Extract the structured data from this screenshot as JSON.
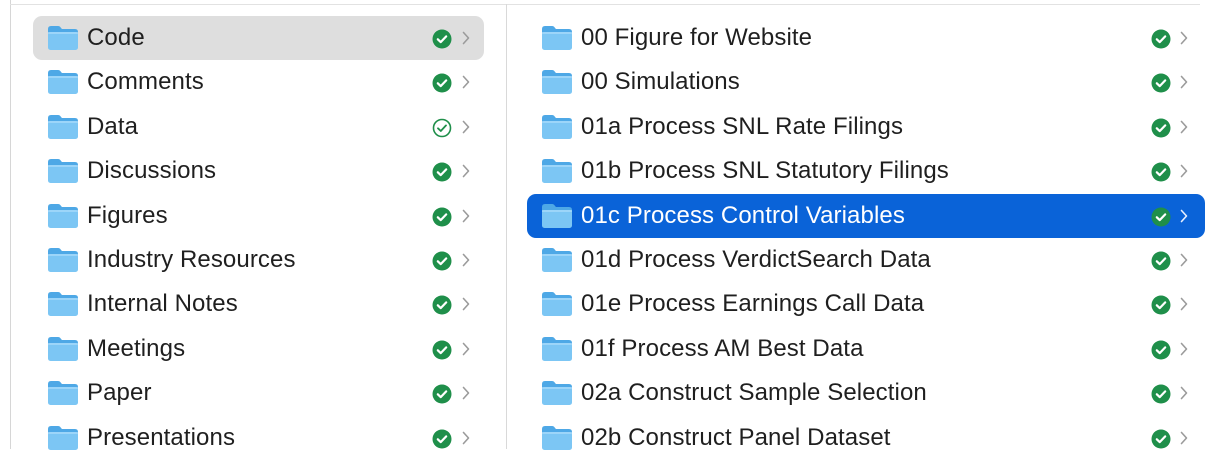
{
  "colors": {
    "folder_light": "#7cc6f4",
    "folder_dark": "#4ea8e6",
    "check_green": "#1f8f4a",
    "selected_blue": "#0a63d8",
    "selected_gray": "#dedede"
  },
  "left_column": {
    "items": [
      {
        "label": "Code",
        "status": "synced",
        "selected": "gray"
      },
      {
        "label": "Comments",
        "status": "synced",
        "selected": ""
      },
      {
        "label": "Data",
        "status": "synced-outline",
        "selected": ""
      },
      {
        "label": "Discussions",
        "status": "synced",
        "selected": ""
      },
      {
        "label": "Figures",
        "status": "synced",
        "selected": ""
      },
      {
        "label": "Industry Resources",
        "status": "synced",
        "selected": ""
      },
      {
        "label": "Internal Notes",
        "status": "synced",
        "selected": ""
      },
      {
        "label": "Meetings",
        "status": "synced",
        "selected": ""
      },
      {
        "label": "Paper",
        "status": "synced",
        "selected": ""
      },
      {
        "label": "Presentations",
        "status": "synced",
        "selected": ""
      }
    ]
  },
  "right_column": {
    "items": [
      {
        "label": "00 Figure for Website",
        "status": "synced",
        "selected": ""
      },
      {
        "label": "00 Simulations",
        "status": "synced",
        "selected": ""
      },
      {
        "label": "01a Process SNL Rate Filings",
        "status": "synced",
        "selected": ""
      },
      {
        "label": "01b Process SNL Statutory Filings",
        "status": "synced",
        "selected": ""
      },
      {
        "label": "01c Process Control Variables",
        "status": "synced",
        "selected": "blue"
      },
      {
        "label": "01d Process VerdictSearch Data",
        "status": "synced",
        "selected": ""
      },
      {
        "label": "01e Process Earnings Call Data",
        "status": "synced",
        "selected": ""
      },
      {
        "label": "01f Process AM Best Data",
        "status": "synced",
        "selected": ""
      },
      {
        "label": "02a Construct Sample Selection",
        "status": "synced",
        "selected": ""
      },
      {
        "label": "02b Construct Panel Dataset",
        "status": "synced",
        "selected": ""
      }
    ]
  }
}
